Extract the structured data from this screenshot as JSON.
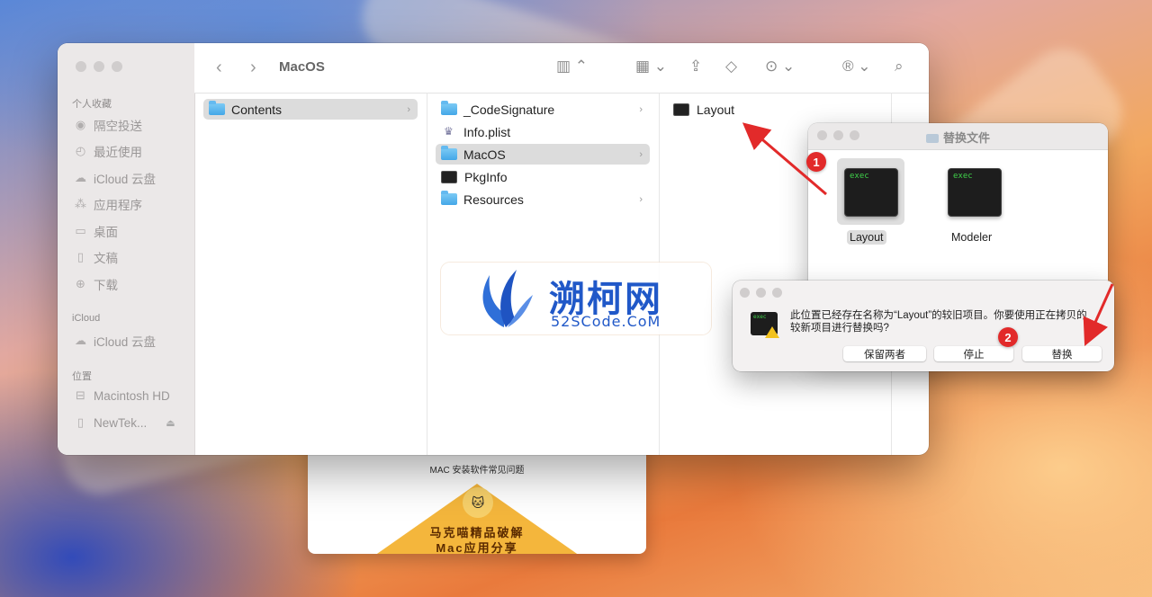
{
  "finder": {
    "title": "MacOS",
    "sidebar": {
      "favorites_label": "个人收藏",
      "favorites": [
        {
          "label": "隔空投送",
          "icon": "airdrop-icon"
        },
        {
          "label": "最近使用",
          "icon": "clock-icon"
        },
        {
          "label": "iCloud 云盘",
          "icon": "cloud-icon"
        },
        {
          "label": "应用程序",
          "icon": "applications-icon"
        },
        {
          "label": "桌面",
          "icon": "desktop-icon"
        },
        {
          "label": "文稿",
          "icon": "document-icon"
        },
        {
          "label": "下载",
          "icon": "download-icon"
        }
      ],
      "icloud_label": "iCloud",
      "icloud": [
        {
          "label": "iCloud 云盘",
          "icon": "cloud-icon"
        }
      ],
      "locations_label": "位置",
      "locations": [
        {
          "label": "Macintosh HD",
          "icon": "disk-icon"
        },
        {
          "label": "NewTek...",
          "icon": "file-icon"
        }
      ]
    },
    "columns": [
      {
        "items": [
          {
            "name": "Contents",
            "kind": "folder",
            "selected": true,
            "chevron": true
          }
        ]
      },
      {
        "items": [
          {
            "name": "_CodeSignature",
            "kind": "folder",
            "selected": false,
            "chevron": true
          },
          {
            "name": "Info.plist",
            "kind": "plist",
            "selected": false,
            "chevron": false
          },
          {
            "name": "MacOS",
            "kind": "folder",
            "selected": true,
            "chevron": true
          },
          {
            "name": "PkgInfo",
            "kind": "terminal",
            "selected": false,
            "chevron": false
          },
          {
            "name": "Resources",
            "kind": "folder",
            "selected": false,
            "chevron": true
          }
        ]
      },
      {
        "items": [
          {
            "name": "Layout",
            "kind": "terminal",
            "selected": false,
            "chevron": false
          }
        ]
      }
    ]
  },
  "replace_window": {
    "title": "替换文件",
    "files": [
      {
        "name": "Layout",
        "icon_text": "exec",
        "selected": true
      },
      {
        "name": "Modeler",
        "icon_text": "exec",
        "selected": false
      }
    ]
  },
  "alert": {
    "icon_text": "exec",
    "message_line1": "此位置已经存在名称为“Layout”的较旧项目。你要使用正在拷贝的",
    "message_line2": "较新项目进行替换吗?",
    "buttons": {
      "keep_both": "保留两者",
      "stop": "停止",
      "replace": "替换"
    }
  },
  "watermark": {
    "title": "溯柯网",
    "subtitle": "52SCode.CoM"
  },
  "helper_doc": {
    "title": "MAC 安装软件常见问题",
    "banner_line1": "马克喵精品破解",
    "banner_line2": "Mac应用分享"
  },
  "annotations": {
    "badge1": "1",
    "badge2": "2",
    "color": "#e22a2a"
  }
}
